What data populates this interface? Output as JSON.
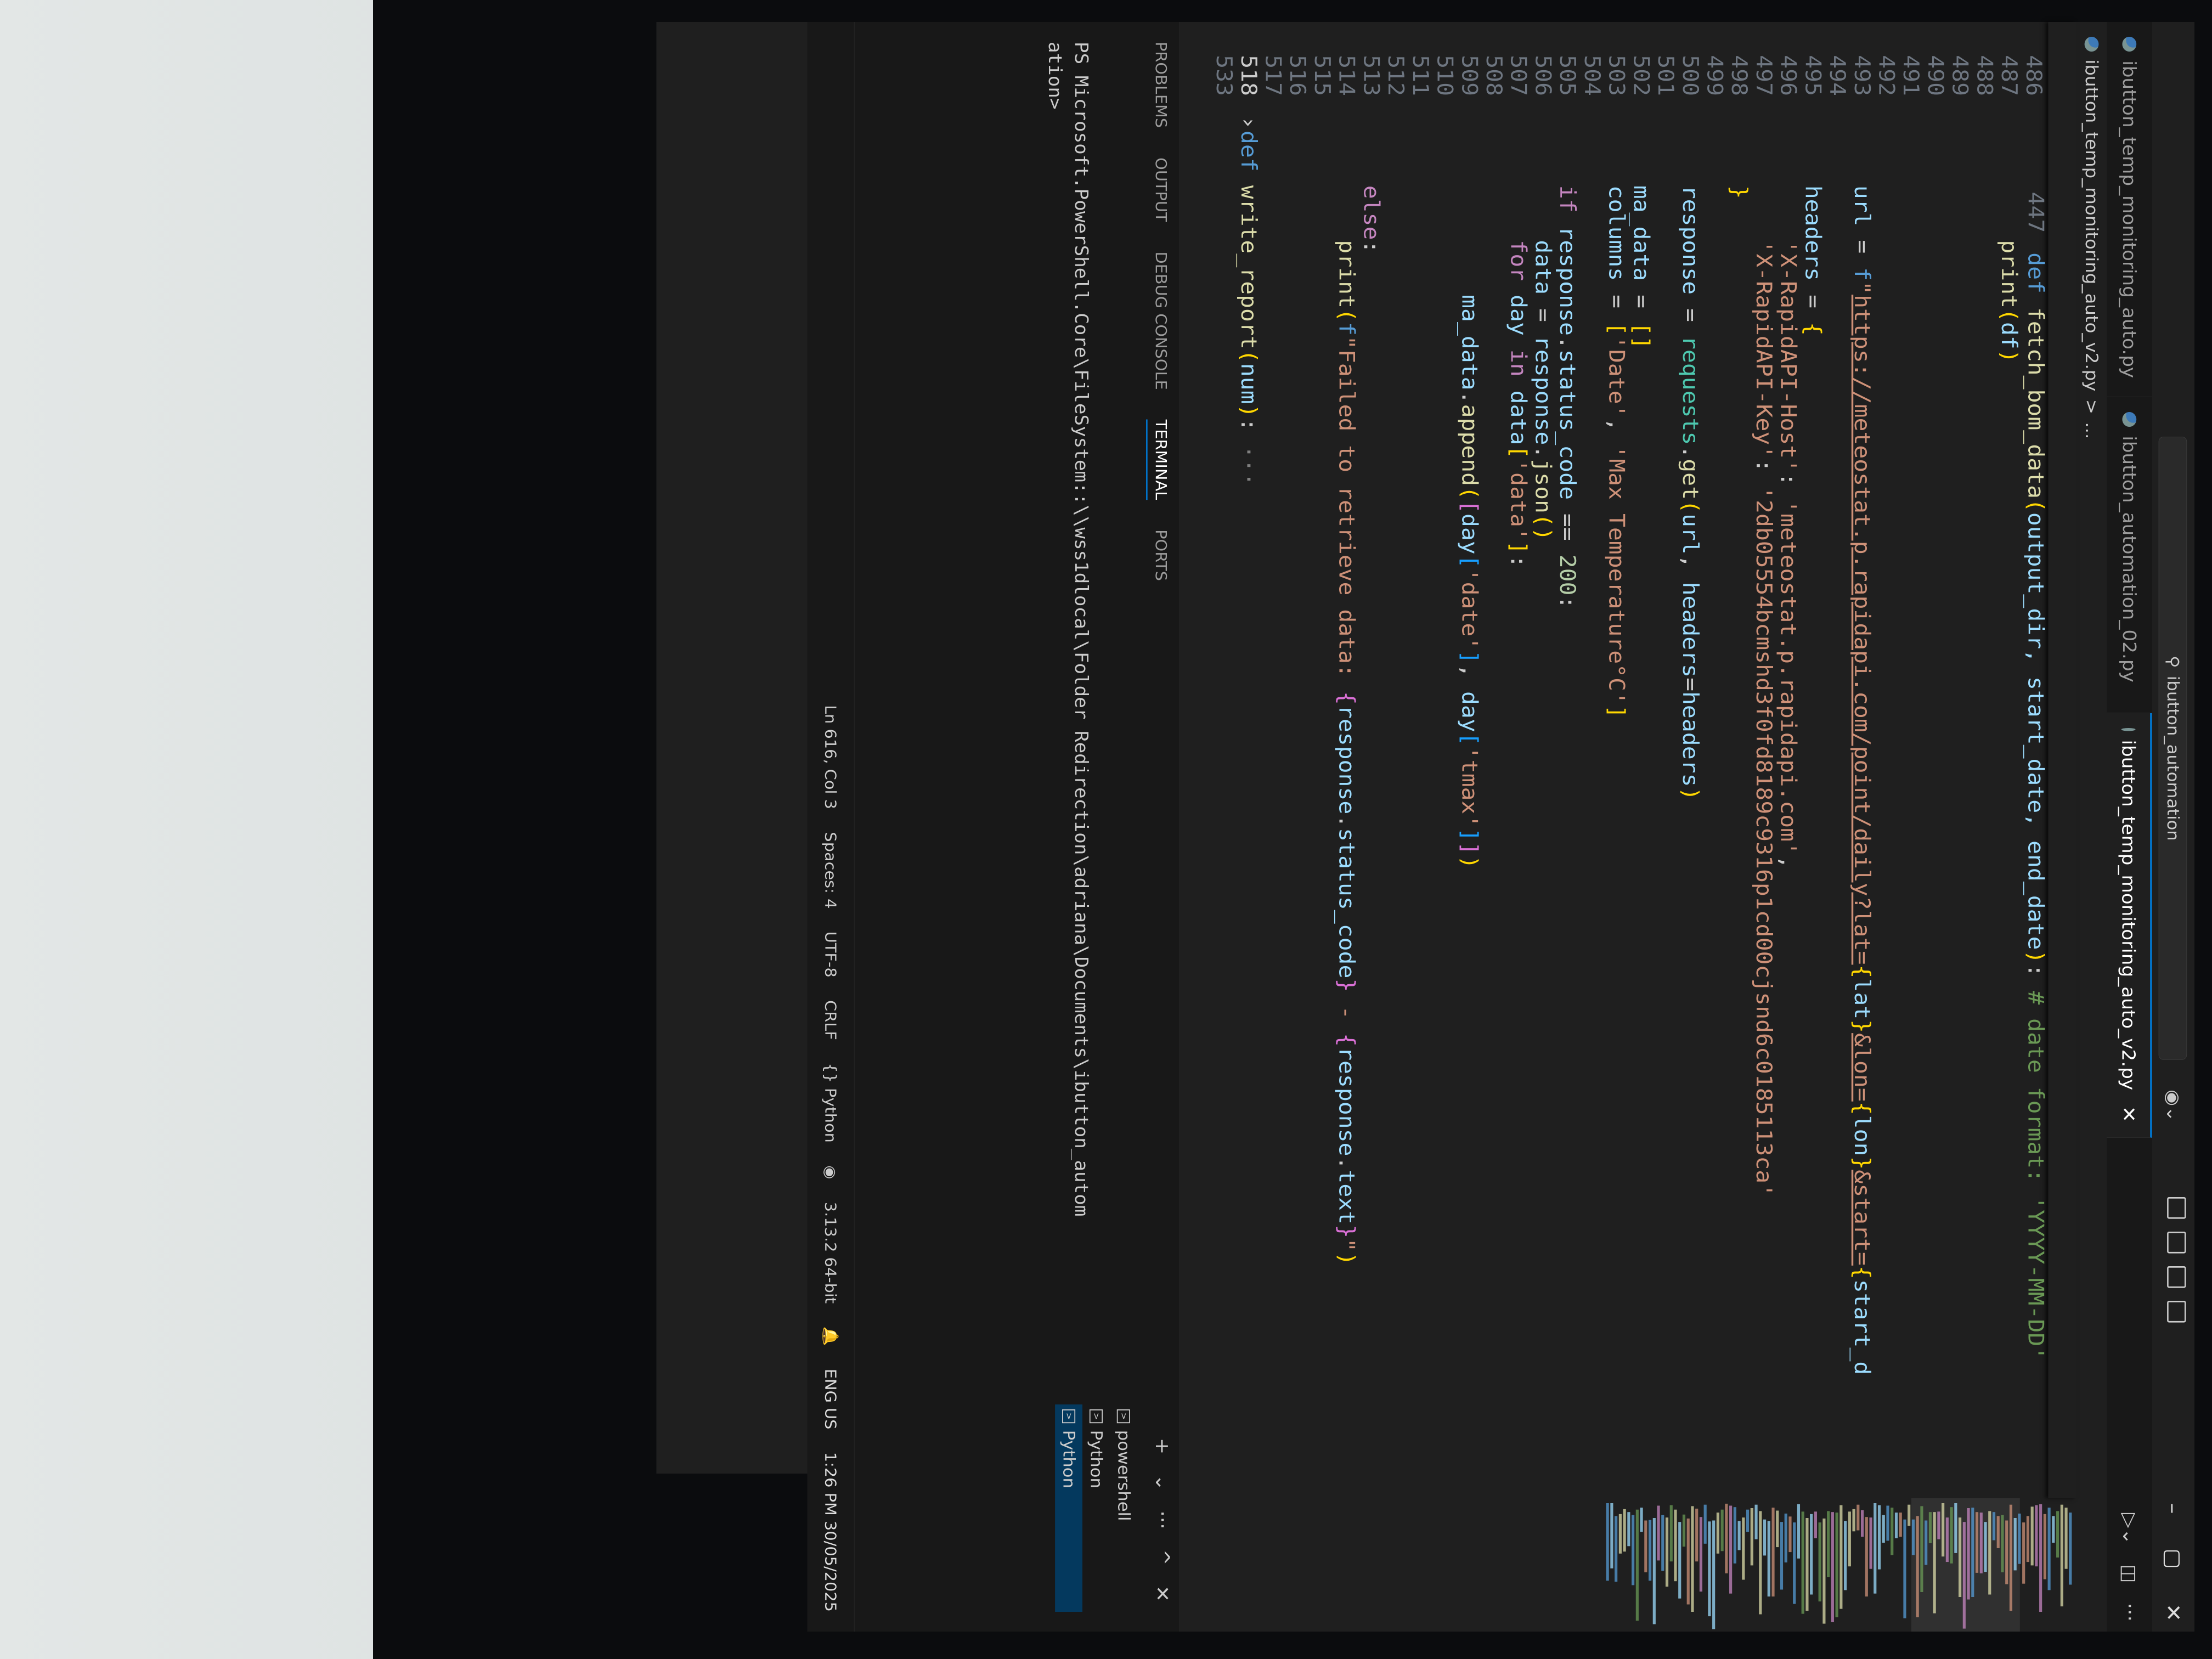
{
  "window": {
    "search_text": "ibutton_automation",
    "controls": {
      "minimize": "–",
      "maximize": "▢",
      "close": "✕"
    }
  },
  "tabs": [
    {
      "label": "ibutton_temp_monitoring_auto.py",
      "active": false
    },
    {
      "label": "ibutton_automation_02.py",
      "active": false
    },
    {
      "label": "ibutton_temp_monitoring_auto_v2.py",
      "active": true
    }
  ],
  "breadcrumb": {
    "file": "ibutton_temp_monitoring_auto_v2.py",
    "separator": ">",
    "more": "..."
  },
  "sticky_line": {
    "number": "447",
    "text_def": "def ",
    "text_fn": "fetch_bom_data",
    "text_params": "output_dir, start_date, end_date",
    "text_comment": "# date format: 'YYYY-MM-DD'"
  },
  "code_lines": [
    {
      "n": "486",
      "html": ""
    },
    {
      "n": "487",
      "html": "        <span class='fn'>print</span><span class='brk1'>(</span><span class='var'>df</span><span class='brk1'>)</span>"
    },
    {
      "n": "488",
      "html": ""
    },
    {
      "n": "489",
      "html": ""
    },
    {
      "n": "490",
      "html": ""
    },
    {
      "n": "491",
      "html": ""
    },
    {
      "n": "492",
      "html": ""
    },
    {
      "n": "493",
      "html": "    <span class='var'>url</span> = <span class='kw'>f</span><span class='str'>\"</span><span class='url'>https://meteostat.p.rapidapi.com/point/daily?lat=</span><span class='brk1'>{</span><span class='var'>lat</span><span class='brk1'>}</span><span class='url'>&amp;lon=</span><span class='brk1'>{</span><span class='var'>lon</span><span class='brk1'>}</span><span class='url'>&amp;start=</span><span class='brk1'>{</span><span class='var'>start_d</span>"
    },
    {
      "n": "494",
      "html": ""
    },
    {
      "n": "495",
      "html": "    <span class='var'>headers</span> = <span class='brk1'>{</span>"
    },
    {
      "n": "496",
      "html": "        <span class='str'>'X-RapidAPI-Host'</span>: <span class='str'>'meteostat.p.rapidapi.com'</span>,"
    },
    {
      "n": "497",
      "html": "        <span class='str'>'X-RapidAPI-Key'</span>: <span class='str'>'2db05554bcmshd3f0fd8189c9316p1cd00cjsnd6c0185113ca'</span>"
    },
    {
      "n": "498",
      "html": "    <span class='brk1'>}</span>"
    },
    {
      "n": "499",
      "html": ""
    },
    {
      "n": "500",
      "html": "    <span class='var'>response</span> = <span class='cls'>requests</span>.<span class='fn'>get</span><span class='brk1'>(</span><span class='var'>url</span>, <span class='var'>headers</span>=<span class='var'>headers</span><span class='brk1'>)</span>"
    },
    {
      "n": "501",
      "html": ""
    },
    {
      "n": "502",
      "html": "    <span class='var'>ma_data</span> = <span class='brk1'>[]</span>"
    },
    {
      "n": "503",
      "html": "    <span class='var'>columns</span> = <span class='brk1'>[</span><span class='str'>'Date'</span>, <span class='str'>'Max Temperature°C'</span><span class='brk1'>]</span>"
    },
    {
      "n": "504",
      "html": ""
    },
    {
      "n": "505",
      "html": "    <span class='kw2'>if</span> <span class='var'>response</span>.<span class='var'>status_code</span> == <span class='num'>200</span>:"
    },
    {
      "n": "506",
      "html": "        <span class='var'>data</span> = <span class='var'>response</span>.<span class='fn'>json</span><span class='brk1'>()</span>"
    },
    {
      "n": "507",
      "html": "        <span class='kw2'>for</span> <span class='var'>day</span> <span class='kw2'>in</span> <span class='var'>data</span><span class='brk1'>[</span><span class='str'>'data'</span><span class='brk1'>]</span>:"
    },
    {
      "n": "508",
      "html": ""
    },
    {
      "n": "509",
      "html": "            <span class='var'>ma_data</span>.<span class='fn'>append</span><span class='brk1'>(</span><span class='brk2'>[</span><span class='var'>day</span><span class='brk3'>[</span><span class='str'>'date'</span><span class='brk3'>]</span>, <span class='var'>day</span><span class='brk3'>[</span><span class='str'>'tmax'</span><span class='brk3'>]</span><span class='brk2'>]</span><span class='brk1'>)</span>"
    },
    {
      "n": "510",
      "html": ""
    },
    {
      "n": "511",
      "html": ""
    },
    {
      "n": "512",
      "html": ""
    },
    {
      "n": "513",
      "html": "    <span class='kw2'>else</span>:"
    },
    {
      "n": "514",
      "html": "        <span class='fn'>print</span><span class='brk1'>(</span><span class='kw'>f</span><span class='str'>\"Failed to retrieve data: </span><span class='brk2'>{</span><span class='var'>response</span>.<span class='var'>status_code</span><span class='brk2'>}</span><span class='str'> - </span><span class='brk2'>{</span><span class='var'>response</span>.<span class='var'>text</span><span class='brk2'>}</span><span class='str'>\"</span><span class='brk1'>)</span>"
    },
    {
      "n": "515",
      "html": ""
    },
    {
      "n": "516",
      "html": ""
    },
    {
      "n": "517",
      "html": ""
    },
    {
      "n": "518",
      "html": "<span class='kw'>def</span> <span class='fn'>write_report</span><span class='brk1'>(</span><span class='var'>num</span><span class='brk1'>)</span>: <span style='color:#808080'>···</span>"
    },
    {
      "n": "533",
      "html": ""
    }
  ],
  "panel": {
    "tabs": [
      "PROBLEMS",
      "OUTPUT",
      "DEBUG CONSOLE",
      "TERMINAL",
      "PORTS"
    ],
    "active_tab": "TERMINAL",
    "terminal_line1": "PS Microsoft.PowerShell.Core\\FileSystem::\\\\wss1dlocal\\Folder Redirection\\adriana\\Documents\\ibutton_autom",
    "terminal_line2": "ation>",
    "terminals": [
      {
        "label": "powershell",
        "active": false
      },
      {
        "label": "Python",
        "active": false
      },
      {
        "label": "Python",
        "active": true
      }
    ],
    "actions": [
      "+",
      "⌄",
      "···",
      "^",
      "✕"
    ]
  },
  "statusbar": {
    "position": "Ln 616, Col 3",
    "spaces": "Spaces: 4",
    "encoding": "UTF-8",
    "eol": "CRLF",
    "language": "{} Python",
    "interpreter": "3.13.2 64-bit",
    "lang_indicator": "ENG",
    "region": "US",
    "time": "1:26 PM",
    "date": "30/05/2025"
  },
  "colors": {
    "accent": "#0078d4",
    "background": "#1f1f1f"
  }
}
